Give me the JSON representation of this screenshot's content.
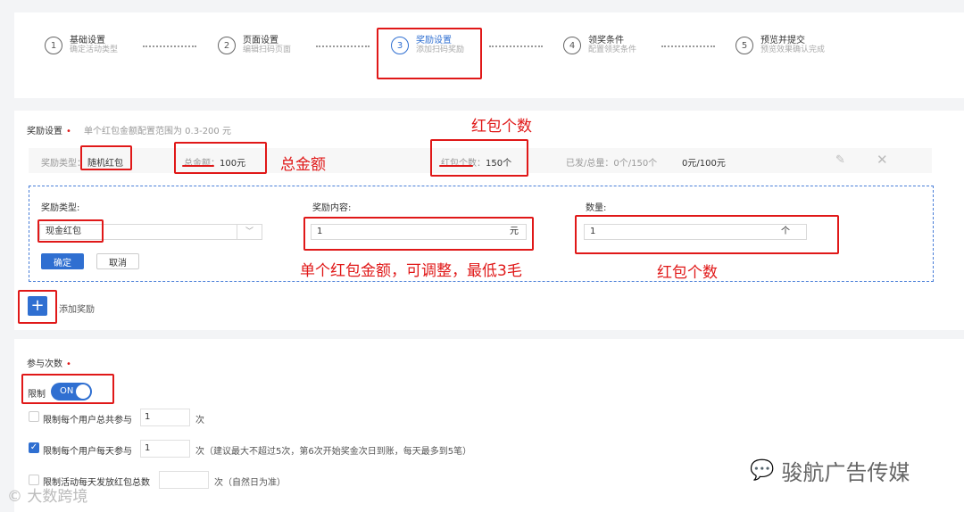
{
  "steps": [
    {
      "num": "1",
      "title": "基础设置",
      "sub": "确定活动类型"
    },
    {
      "num": "2",
      "title": "页面设置",
      "sub": "编辑扫码页面"
    },
    {
      "num": "3",
      "title": "奖励设置",
      "sub": "添加扫码奖励"
    },
    {
      "num": "4",
      "title": "领奖条件",
      "sub": "配置领奖条件"
    },
    {
      "num": "5",
      "title": "预览并提交",
      "sub": "预览效果确认完成"
    }
  ],
  "reward": {
    "title": "奖励设置",
    "hint": "单个红包金额配置范围为 0.3-200 元",
    "summary": {
      "type_label": "奖励类型：",
      "type_value": "随机红包",
      "total_label": "总金额：",
      "total_value": "100元",
      "count_label": "红包个数：",
      "count_value": "150个",
      "issued": "已发/总量：0个/150个",
      "amount": "0元/100元"
    },
    "form": {
      "type_label": "奖励类型:",
      "type_value": "现金红包",
      "content_label": "奖励内容:",
      "content_value": "1",
      "content_unit": "元",
      "qty_label": "数量:",
      "qty_value": "1",
      "qty_unit": "个",
      "confirm": "确定",
      "cancel": "取消"
    },
    "add_label": "添加奖励"
  },
  "join": {
    "title": "参与次数",
    "limit_label": "限制",
    "toggle": "ON",
    "options": [
      {
        "label": "限制每个用户总共参与",
        "value": "1",
        "suffix": "次",
        "checked": false
      },
      {
        "label": "限制每个用户每天参与",
        "value": "1",
        "suffix": "次（建议最大不超过5次，第6次开始奖金次日到账，每天最多到5笔）",
        "checked": true
      },
      {
        "label": "限制活动每天发放红包总数",
        "value": "",
        "suffix": "次（自然日为准）",
        "checked": false
      }
    ]
  },
  "annotations": {
    "total_amount": "总金额",
    "count_top": "红包个数",
    "single_amount": "单个红包金额，可调整，最低3毛",
    "count_bottom": "红包个数"
  },
  "watermarks": {
    "left": "大数跨境",
    "right": "骏航广告传媒"
  },
  "colors": {
    "accent": "#2f6fd1",
    "annotation": "#e01818"
  }
}
